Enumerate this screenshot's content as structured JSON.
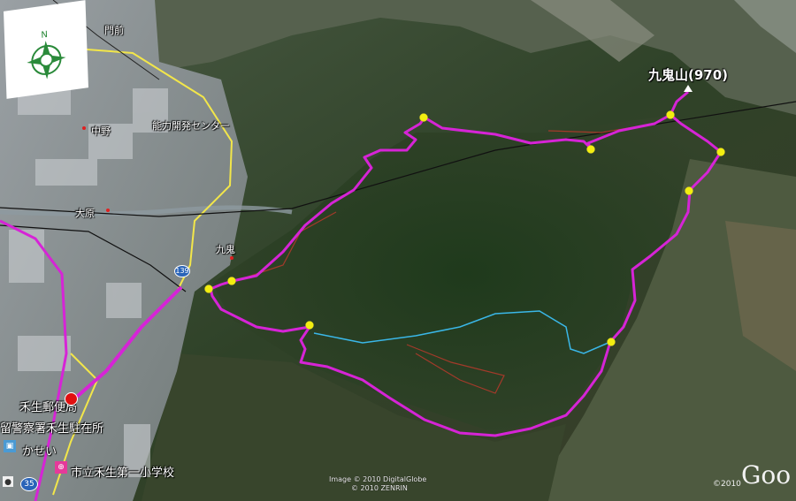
{
  "summit": {
    "label": "九鬼山(970)"
  },
  "places": [
    {
      "id": "monzen",
      "label": "門前"
    },
    {
      "id": "nakano",
      "label": "中野"
    },
    {
      "id": "center",
      "label": "能力開発センター"
    },
    {
      "id": "ohara",
      "label": "大原"
    },
    {
      "id": "kuki",
      "label": "九鬼"
    },
    {
      "id": "post",
      "label": "禾生郵便局"
    },
    {
      "id": "police",
      "label": "留警察署禾生駐在所"
    },
    {
      "id": "kasei",
      "label": "かせい"
    },
    {
      "id": "school",
      "label": "市立禾生第一小学校"
    }
  ],
  "road_shields": {
    "route139": "139",
    "route35": "35"
  },
  "credits": {
    "line1": "Image © 2010 DigitalGlobe",
    "line2": "© 2010 ZENRIN",
    "copyright": "©2010",
    "brand": "Goo"
  },
  "colors": {
    "track": "#d624d6",
    "stream": "#3ab7e8",
    "waypoint": "#f2ee10",
    "trail_red": "#a33a2a"
  },
  "compass": {
    "north_label": "N"
  }
}
